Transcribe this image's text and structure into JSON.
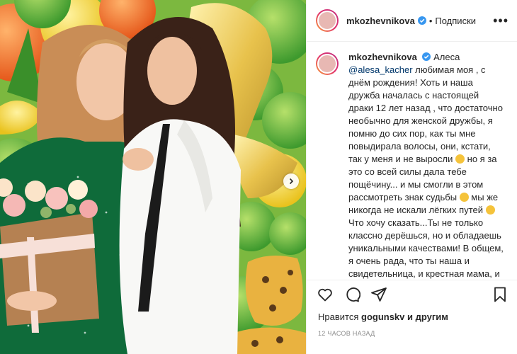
{
  "post": {
    "username": "mkozhevnikova",
    "follow_label": "Подписки",
    "separator": "•",
    "more_label": "•••"
  },
  "caption": {
    "username": "mkozhevnikova",
    "lines": [
      "Алеса",
      "@alesa_kacher любимая моя , с днём рождения! Хоть и наша дружба началась с настоящей драки 12 лет назад , что достаточно необычно для женской дружбы, я помню до сих пор, как ты мне повыдирала волосы, они, кстати, так у меня и не выросли",
      " но я за это со всей силы дала тебе пощёчину... и мы смогли в этом рассмотреть знак судьбы",
      " мы же никогда не искали лёгких путей",
      "Что хочу сказать...Ты не только классно дерёшься, но и обладаешь уникальными качествами! В общем, я очень рада, что ты наша и свидетельница, и крестная мама, и очень мне близкий человек! Люблю тебя и хочу чтобы ты была здорова"
    ],
    "mention": "@alesa_kacher"
  },
  "likes": {
    "prefix": "Нравится",
    "user": "gogunskv",
    "suffix": "и другим"
  },
  "time": "12 часов назад",
  "icons": {
    "like": "heart-icon",
    "comment": "comment-icon",
    "share": "share-icon",
    "save": "bookmark-icon",
    "verified": "verified-badge-icon",
    "next": "chevron-right-icon"
  },
  "colors": {
    "verified": "#3897f0",
    "mention": "#00376b",
    "muted": "#8e8e8e",
    "border": "#efefef"
  }
}
